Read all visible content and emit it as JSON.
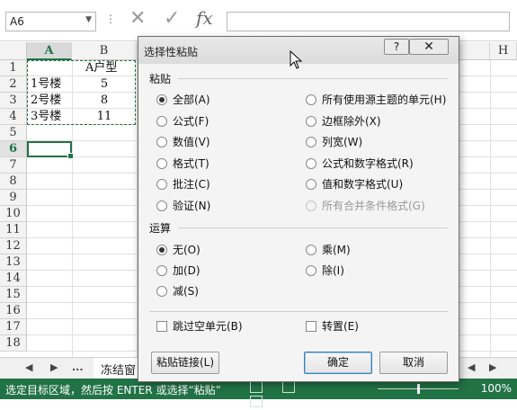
{
  "formula_bar": {
    "name_box": "A6",
    "dropdown_icon": "chevron-down-icon",
    "more_icon": "ellipsis-icon",
    "cancel_icon": "close-icon",
    "enter_icon": "check-icon",
    "fx_label": "fx",
    "formula": ""
  },
  "grid": {
    "columns": [
      "A",
      "B",
      "H"
    ],
    "rows": [
      "1",
      "2",
      "3",
      "4",
      "5",
      "6",
      "7",
      "8",
      "9",
      "10",
      "11",
      "12",
      "13",
      "14",
      "15",
      "16",
      "17",
      "18"
    ],
    "cells": {
      "B1": "A户型",
      "A2": "1号楼",
      "B2": "5",
      "A3": "2号楼",
      "B3": "8",
      "A4": "3号楼",
      "B4": "11"
    },
    "selected_cell": "A6"
  },
  "sheet_tabs": {
    "ellipsis": "...",
    "sheet_name": "冻结窗"
  },
  "status_bar": {
    "message": "选定目标区域，然后按 ENTER 或选择“粘贴”",
    "zoom": "100%"
  },
  "dialog": {
    "title": "选择性粘贴",
    "help_label": "?",
    "close_label": "✕",
    "paste_group": "粘贴",
    "paste_options": [
      {
        "label": "全部(A)",
        "checked": true,
        "disabled": false
      },
      {
        "label": "公式(F)",
        "checked": false,
        "disabled": false
      },
      {
        "label": "数值(V)",
        "checked": false,
        "disabled": false
      },
      {
        "label": "格式(T)",
        "checked": false,
        "disabled": false
      },
      {
        "label": "批注(C)",
        "checked": false,
        "disabled": false
      },
      {
        "label": "验证(N)",
        "checked": false,
        "disabled": false
      },
      {
        "label": "所有使用源主题的单元(H)",
        "checked": false,
        "disabled": false
      },
      {
        "label": "边框除外(X)",
        "checked": false,
        "disabled": false
      },
      {
        "label": "列宽(W)",
        "checked": false,
        "disabled": false
      },
      {
        "label": "公式和数字格式(R)",
        "checked": false,
        "disabled": false
      },
      {
        "label": "值和数字格式(U)",
        "checked": false,
        "disabled": false
      },
      {
        "label": "所有合并条件格式(G)",
        "checked": false,
        "disabled": true
      }
    ],
    "operation_group": "运算",
    "operation_options": [
      {
        "label": "无(O)",
        "checked": true
      },
      {
        "label": "加(D)",
        "checked": false
      },
      {
        "label": "减(S)",
        "checked": false
      },
      {
        "label": "乘(M)",
        "checked": false
      },
      {
        "label": "除(I)",
        "checked": false
      }
    ],
    "skip_blanks": "跳过空单元(B)",
    "transpose": "转置(E)",
    "paste_link_button": "粘贴链接(L)",
    "ok_button": "确定",
    "cancel_button": "取消"
  }
}
